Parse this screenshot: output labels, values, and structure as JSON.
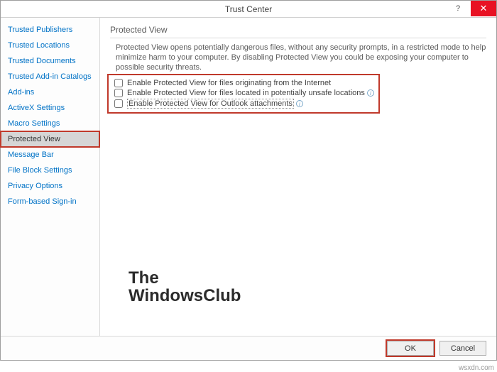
{
  "window": {
    "title": "Trust Center",
    "help_glyph": "?",
    "close_glyph": "✕"
  },
  "sidebar": {
    "items": [
      {
        "label": "Trusted Publishers",
        "selected": false
      },
      {
        "label": "Trusted Locations",
        "selected": false
      },
      {
        "label": "Trusted Documents",
        "selected": false
      },
      {
        "label": "Trusted Add-in Catalogs",
        "selected": false
      },
      {
        "label": "Add-ins",
        "selected": false
      },
      {
        "label": "ActiveX Settings",
        "selected": false
      },
      {
        "label": "Macro Settings",
        "selected": false
      },
      {
        "label": "Protected View",
        "selected": true
      },
      {
        "label": "Message Bar",
        "selected": false
      },
      {
        "label": "File Block Settings",
        "selected": false
      },
      {
        "label": "Privacy Options",
        "selected": false
      },
      {
        "label": "Form-based Sign-in",
        "selected": false
      }
    ]
  },
  "content": {
    "section_title": "Protected View",
    "description": "Protected View opens potentially dangerous files, without any security prompts, in a restricted mode to help minimize harm to your computer. By disabling Protected View you could be exposing your computer to possible security threats.",
    "checkboxes": [
      {
        "label": "Enable Protected View for files originating from the Internet",
        "checked": false,
        "info": false,
        "focus": false
      },
      {
        "label": "Enable Protected View for files located in potentially unsafe locations",
        "checked": false,
        "info": true,
        "focus": false
      },
      {
        "label": "Enable Protected View for Outlook attachments",
        "checked": false,
        "info": true,
        "focus": true
      }
    ]
  },
  "footer": {
    "ok": "OK",
    "cancel": "Cancel"
  },
  "watermark": {
    "line1": "The",
    "line2": "WindowsClub"
  },
  "source": "wsxdn.com"
}
